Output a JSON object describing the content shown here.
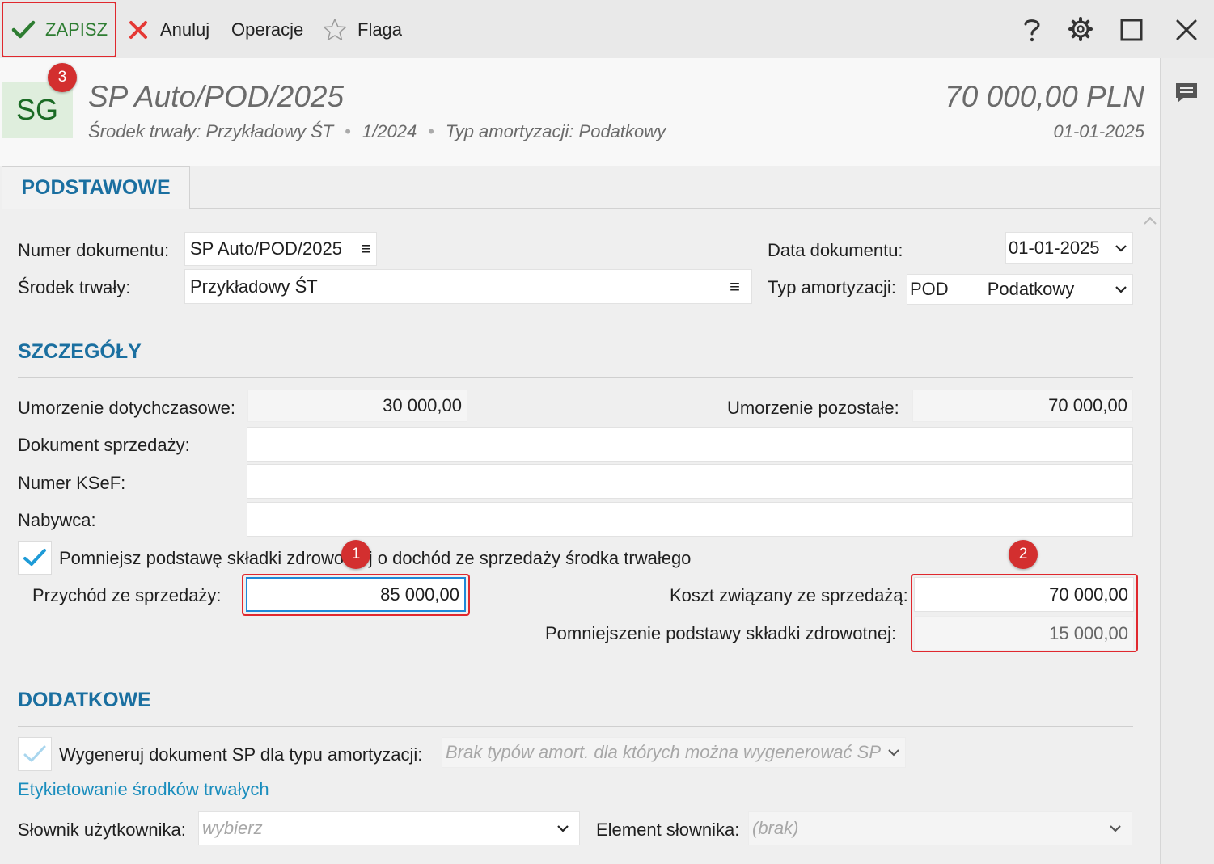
{
  "toolbar": {
    "save": "ZAPISZ",
    "cancel": "Anuluj",
    "operations": "Operacje",
    "flag": "Flaga"
  },
  "badges": {
    "b1": "1",
    "b2": "2",
    "b3": "3"
  },
  "header": {
    "avatar": "SG",
    "title": "SP Auto/POD/2025",
    "subtitle_asset": "Środek trwały: Przykładowy ŚT",
    "subtitle_number": "1/2024",
    "subtitle_type": "Typ amortyzacji: Podatkowy",
    "sep": "•",
    "amount": "70 000,00 PLN",
    "date": "01-01-2025"
  },
  "tabs": {
    "basic": "PODSTAWOWE"
  },
  "basic": {
    "doc_number_label": "Numer dokumentu:",
    "doc_number_value": "SP Auto/POD/2025",
    "asset_label": "Środek trwały:",
    "asset_value": "Przykładowy ŚT",
    "doc_date_label": "Data dokumentu:",
    "doc_date_value": "01-01-2025",
    "amort_type_label": "Typ amortyzacji:",
    "amort_type_code": "POD",
    "amort_type_name": "Podatkowy"
  },
  "details": {
    "heading": "SZCZEGÓŁY",
    "depr_so_far_label": "Umorzenie dotychczasowe:",
    "depr_so_far_value": "30 000,00",
    "depr_remaining_label": "Umorzenie pozostałe:",
    "depr_remaining_value": "70 000,00",
    "sales_doc_label": "Dokument sprzedaży:",
    "ksef_label": "Numer KSeF:",
    "buyer_label": "Nabywca:",
    "reduce_checkbox_label": "Pomniejsz podstawę składki zdrowotnej o dochód ze sprzedaży środka trwałego",
    "revenue_label": "Przychód ze sprzedaży:",
    "revenue_value": "85 000,00",
    "cost_label": "Koszt związany ze sprzedażą:",
    "cost_value": "70 000,00",
    "reduction_label": "Pomniejszenie podstawy składki zdrowotnej:",
    "reduction_value": "15 000,00"
  },
  "additional": {
    "heading": "DODATKOWE",
    "generate_label": "Wygeneruj dokument SP dla typu amortyzacji:",
    "generate_placeholder": "Brak typów amort. dla których można wygenerować SP",
    "labeling_link": "Etykietowanie środków trwałych",
    "dict_label": "Słownik użytkownika:",
    "dict_placeholder": "wybierz",
    "element_label": "Element słownika:",
    "element_placeholder": "(brak)"
  },
  "colors": {
    "accent": "#1a6fa0",
    "save_green": "#2e7d32",
    "highlight_red": "#e0282e",
    "cancel_red": "#e53935",
    "check_blue": "#1e9bd7"
  }
}
